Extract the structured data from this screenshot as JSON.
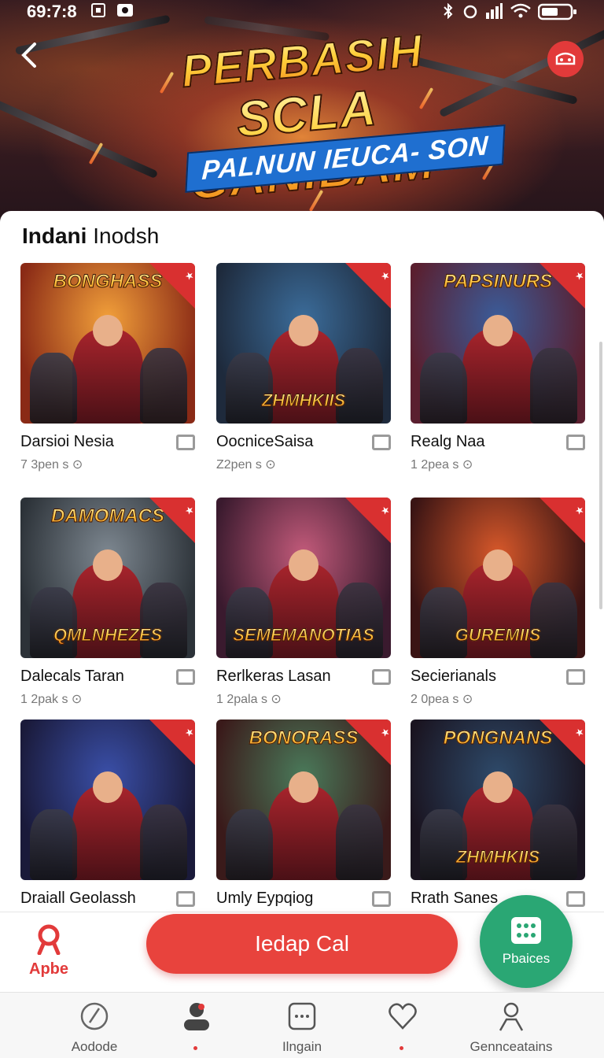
{
  "status": {
    "time": "69:7:8"
  },
  "banner": {
    "title_line1": "PERBASIH",
    "title_line2": "SCLA GANIBAM",
    "subtitle": "PALNUN IEUCA- SON"
  },
  "section": {
    "title_bold": "Indani",
    "title_rest": " Inodsh"
  },
  "cards": [
    {
      "title": "Darsioi Nesia",
      "meta": "7 3pen s ⊙",
      "logo_top": "BONGHASS",
      "logo_bottom": "",
      "colors": [
        "#f2a03a",
        "#8a2a16"
      ]
    },
    {
      "title": "OocniceSaisa",
      "meta": "Z2pen s ⊙",
      "logo_top": "",
      "logo_bottom": "ZHMHKIIS",
      "colors": [
        "#3b6c9a",
        "#1e2a3c"
      ]
    },
    {
      "title": "Realg Naa",
      "meta": "1 2pea s ⊙",
      "logo_top": "PAPSINURS",
      "logo_bottom": "",
      "colors": [
        "#3a5c9a",
        "#5a1f2f"
      ]
    },
    {
      "title": "Dalecals Taran",
      "meta": "1 2pak s ⊙",
      "logo_top": "DAMOMACS",
      "logo_bottom": "QMLNHEZES",
      "colors": [
        "#7d8790",
        "#2c3238"
      ]
    },
    {
      "title": "Rerlkeras Lasan",
      "meta": "1 2pala s ⊙",
      "logo_top": "",
      "logo_bottom": "SEMEMANOTIAS",
      "colors": [
        "#c25a7a",
        "#3a1a2e"
      ]
    },
    {
      "title": "Secierianals",
      "meta": "2 0pea s ⊙",
      "logo_top": "",
      "logo_bottom": "GUREMIIS",
      "colors": [
        "#d7582a",
        "#3a1414"
      ]
    },
    {
      "title": "Draiall Geolassh",
      "meta": "",
      "logo_top": "",
      "logo_bottom": "",
      "colors": [
        "#3a4fa8",
        "#1a1a3a"
      ]
    },
    {
      "title": "Umly Eypqiog",
      "meta": "",
      "logo_top": "BONORASS",
      "logo_bottom": "",
      "colors": [
        "#4a7a5a",
        "#3a1a1a"
      ]
    },
    {
      "title": "Rrath Sanes",
      "meta": "",
      "logo_top": "PONGNANS",
      "logo_bottom": "ZHMHKIIS",
      "colors": [
        "#2e4a6a",
        "#1a1420"
      ]
    }
  ],
  "action_bar": {
    "brand_label": "Apbe",
    "cta_label": "Iedap Cal",
    "fab_label": "Pbaices"
  },
  "nav": [
    {
      "label": "Aodode",
      "icon": "compass-icon"
    },
    {
      "label": "",
      "icon": "profile-icon"
    },
    {
      "label": "Ilngain",
      "icon": "chat-icon"
    },
    {
      "label": "",
      "icon": "heart-icon"
    },
    {
      "label": "Gennceatains",
      "icon": "person-icon"
    }
  ]
}
